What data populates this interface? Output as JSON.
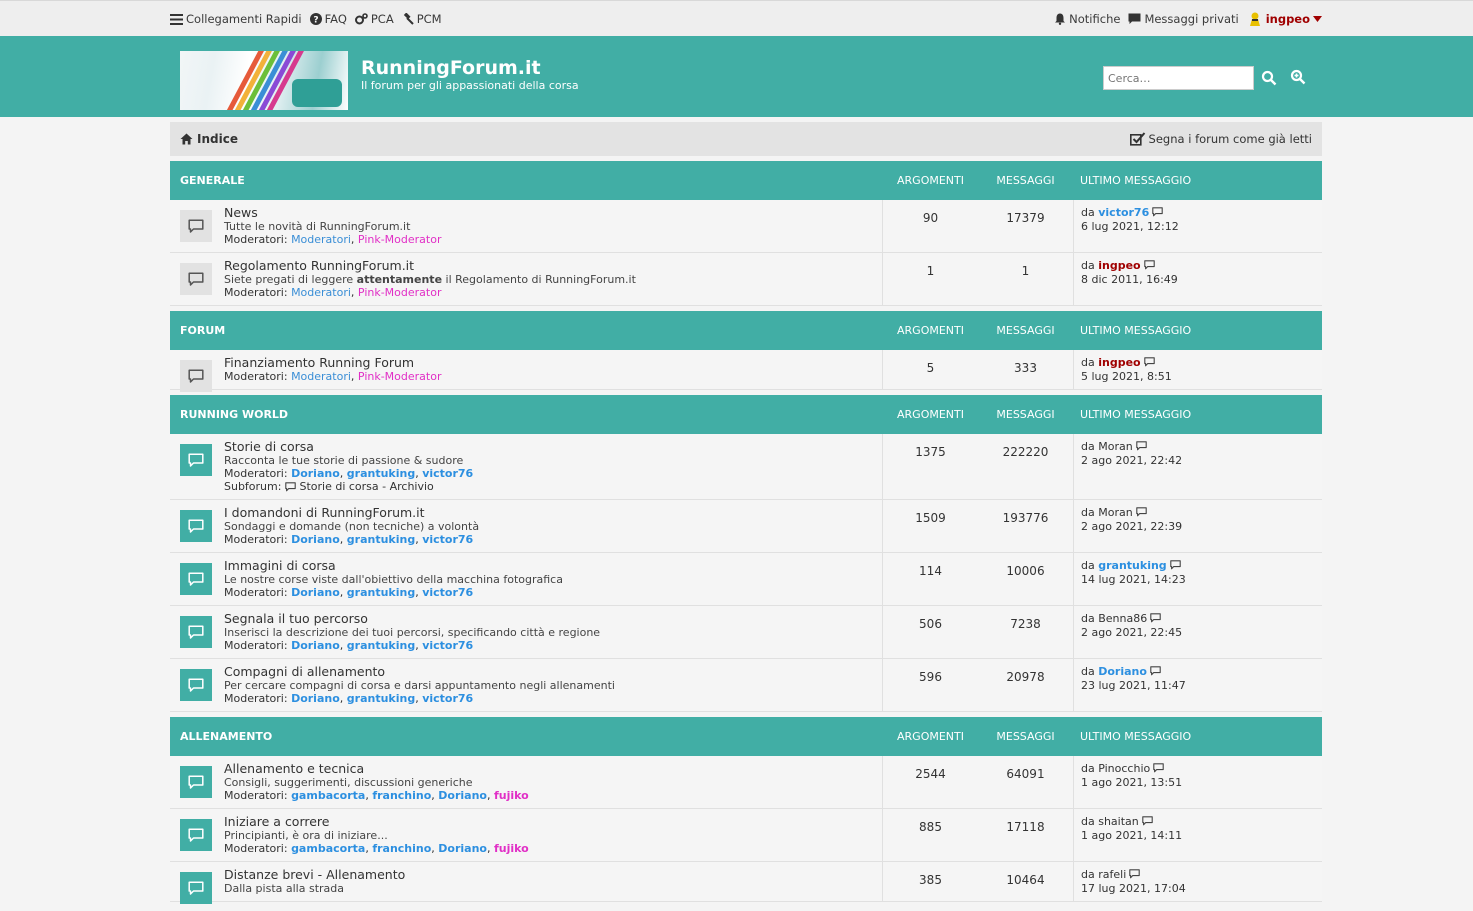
{
  "topbar": {
    "quick_links": "Collegamenti Rapidi",
    "faq": "FAQ",
    "pca": "PCA",
    "pcm": "PCM",
    "notifications": "Notifiche",
    "private_messages": "Messaggi privati",
    "username": "ingpeo"
  },
  "header": {
    "title": "RunningForum.it",
    "description": "Il forum per gli appassionati della corsa",
    "search_placeholder": "Cerca…"
  },
  "navbar": {
    "index": "Indice",
    "mark_read": "Segna i forum come già letti"
  },
  "columns": {
    "topics": "ARGOMENTI",
    "posts": "MESSAGGI",
    "last_post": "ULTIMO MESSAGGIO"
  },
  "by": "da",
  "moderators_label": "Moderatori:",
  "subforum_label": "Subforum:",
  "categories": [
    {
      "title": "GENERALE",
      "forums": [
        {
          "title": "News",
          "desc": "Tutte le novità di RunningForum.it",
          "desc_bold": "",
          "desc_after": "",
          "topics": "90",
          "posts": "17379",
          "last_user": "victor76",
          "last_user_style": "blue",
          "last_date": "6 lug 2021, 12:12",
          "unread": false,
          "mods": [
            {
              "name": "Moderatori",
              "style": "blue"
            },
            {
              "name": "Pink-Moderator",
              "style": "pink"
            }
          ]
        },
        {
          "title": "Regolamento RunningForum.it",
          "desc": "Siete pregati di leggere ",
          "desc_bold": "attentamente",
          "desc_after": " il Regolamento di RunningForum.it",
          "topics": "1",
          "posts": "1",
          "last_user": "ingpeo",
          "last_user_style": "red",
          "last_date": "8 dic 2011, 16:49",
          "unread": false,
          "mods": [
            {
              "name": "Moderatori",
              "style": "blue"
            },
            {
              "name": "Pink-Moderator",
              "style": "pink"
            }
          ]
        }
      ]
    },
    {
      "title": "FORUM",
      "forums": [
        {
          "title": "Finanziamento Running Forum",
          "desc": "",
          "desc_bold": "",
          "desc_after": "",
          "topics": "5",
          "posts": "333",
          "last_user": "ingpeo",
          "last_user_style": "red",
          "last_date": "5 lug 2021, 8:51",
          "unread": false,
          "mods": [
            {
              "name": "Moderatori",
              "style": "blue"
            },
            {
              "name": "Pink-Moderator",
              "style": "pink"
            }
          ]
        }
      ]
    },
    {
      "title": "RUNNING WORLD",
      "forums": [
        {
          "title": "Storie di corsa",
          "desc": "Racconta le tue storie di passione & sudore",
          "desc_bold": "",
          "desc_after": "",
          "topics": "1375",
          "posts": "222220",
          "last_user": "Moran",
          "last_user_style": "plain",
          "last_date": "2 ago 2021, 22:42",
          "unread": true,
          "mods": [
            {
              "name": "Doriano",
              "style": "bblue"
            },
            {
              "name": "grantuking",
              "style": "bblue"
            },
            {
              "name": "victor76",
              "style": "bblue"
            }
          ],
          "subforum": "Storie di corsa - Archivio"
        },
        {
          "title": "I domandoni di RunningForum.it",
          "desc": "Sondaggi e domande (non tecniche) a volontà",
          "desc_bold": "",
          "desc_after": "",
          "topics": "1509",
          "posts": "193776",
          "last_user": "Moran",
          "last_user_style": "plain",
          "last_date": "2 ago 2021, 22:39",
          "unread": true,
          "mods": [
            {
              "name": "Doriano",
              "style": "bblue"
            },
            {
              "name": "grantuking",
              "style": "bblue"
            },
            {
              "name": "victor76",
              "style": "bblue"
            }
          ]
        },
        {
          "title": "Immagini di corsa",
          "desc": "Le nostre corse viste dall'obiettivo della macchina fotografica",
          "desc_bold": "",
          "desc_after": "",
          "topics": "114",
          "posts": "10006",
          "last_user": "grantuking",
          "last_user_style": "blue",
          "last_date": "14 lug 2021, 14:23",
          "unread": true,
          "mods": [
            {
              "name": "Doriano",
              "style": "bblue"
            },
            {
              "name": "grantuking",
              "style": "bblue"
            },
            {
              "name": "victor76",
              "style": "bblue"
            }
          ]
        },
        {
          "title": "Segnala il tuo percorso",
          "desc": "Inserisci la descrizione dei tuoi percorsi, specificando città e regione",
          "desc_bold": "",
          "desc_after": "",
          "topics": "506",
          "posts": "7238",
          "last_user": "Benna86",
          "last_user_style": "plain",
          "last_date": "2 ago 2021, 22:45",
          "unread": true,
          "mods": [
            {
              "name": "Doriano",
              "style": "bblue"
            },
            {
              "name": "grantuking",
              "style": "bblue"
            },
            {
              "name": "victor76",
              "style": "bblue"
            }
          ]
        },
        {
          "title": "Compagni di allenamento",
          "desc": "Per cercare compagni di corsa e darsi appuntamento negli allenamenti",
          "desc_bold": "",
          "desc_after": "",
          "topics": "596",
          "posts": "20978",
          "last_user": "Doriano",
          "last_user_style": "blue",
          "last_date": "23 lug 2021, 11:47",
          "unread": true,
          "mods": [
            {
              "name": "Doriano",
              "style": "bblue"
            },
            {
              "name": "grantuking",
              "style": "bblue"
            },
            {
              "name": "victor76",
              "style": "bblue"
            }
          ]
        }
      ]
    },
    {
      "title": "ALLENAMENTO",
      "forums": [
        {
          "title": "Allenamento e tecnica",
          "desc": "Consigli, suggerimenti, discussioni generiche",
          "desc_bold": "",
          "desc_after": "",
          "topics": "2544",
          "posts": "64091",
          "last_user": "Pinocchio",
          "last_user_style": "plain",
          "last_date": "1 ago 2021, 13:51",
          "unread": true,
          "mods": [
            {
              "name": "gambacorta",
              "style": "bblue"
            },
            {
              "name": "franchino",
              "style": "bblue"
            },
            {
              "name": "Doriano",
              "style": "bblue"
            },
            {
              "name": "fujiko",
              "style": "bpink"
            }
          ]
        },
        {
          "title": "Iniziare a correre",
          "desc": "Principianti, è ora di iniziare...",
          "desc_bold": "",
          "desc_after": "",
          "topics": "885",
          "posts": "17118",
          "last_user": "shaitan",
          "last_user_style": "plain",
          "last_date": "1 ago 2021, 14:11",
          "unread": true,
          "mods": [
            {
              "name": "gambacorta",
              "style": "bblue"
            },
            {
              "name": "franchino",
              "style": "bblue"
            },
            {
              "name": "Doriano",
              "style": "bblue"
            },
            {
              "name": "fujiko",
              "style": "bpink"
            }
          ]
        },
        {
          "title": "Distanze brevi - Allenamento",
          "desc": "Dalla pista alla strada",
          "desc_bold": "",
          "desc_after": "",
          "topics": "385",
          "posts": "10464",
          "last_user": "rafeli",
          "last_user_style": "plain",
          "last_date": "17 lug 2021, 17:04",
          "unread": true,
          "mods": []
        }
      ]
    }
  ],
  "colors": {
    "teal": "#41aea5",
    "user_red": "#a00000",
    "user_blue": "#2c8fe0",
    "pink": "#e12fc6"
  }
}
